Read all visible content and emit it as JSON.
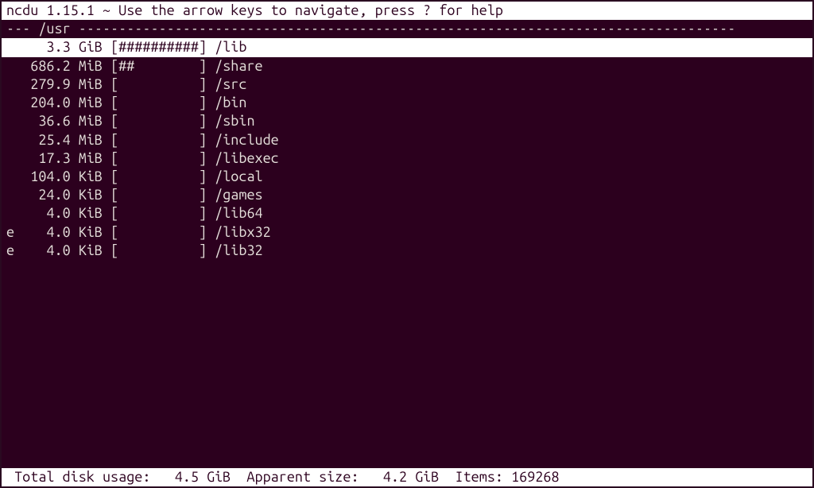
{
  "header": {
    "app_version": "ncdu 1.15.1 ~ Use the arrow keys to navigate, press ",
    "help_key": "?",
    "help_suffix": " for help"
  },
  "path": {
    "prefix": "--- ",
    "dir": "/usr",
    "dashes": " ----------------------------------------------------------------------------------"
  },
  "rows": [
    {
      "flag": " ",
      "size": "    3.3 GiB",
      "bar": "[##########]",
      "name": " /lib",
      "selected": true
    },
    {
      "flag": " ",
      "size": "  686.2 MiB",
      "bar": "[##        ]",
      "name": " /share",
      "selected": false
    },
    {
      "flag": " ",
      "size": "  279.9 MiB",
      "bar": "[          ]",
      "name": " /src",
      "selected": false
    },
    {
      "flag": " ",
      "size": "  204.0 MiB",
      "bar": "[          ]",
      "name": " /bin",
      "selected": false
    },
    {
      "flag": " ",
      "size": "   36.6 MiB",
      "bar": "[          ]",
      "name": " /sbin",
      "selected": false
    },
    {
      "flag": " ",
      "size": "   25.4 MiB",
      "bar": "[          ]",
      "name": " /include",
      "selected": false
    },
    {
      "flag": " ",
      "size": "   17.3 MiB",
      "bar": "[          ]",
      "name": " /libexec",
      "selected": false
    },
    {
      "flag": " ",
      "size": "  104.0 KiB",
      "bar": "[          ]",
      "name": " /local",
      "selected": false
    },
    {
      "flag": " ",
      "size": "   24.0 KiB",
      "bar": "[          ]",
      "name": " /games",
      "selected": false
    },
    {
      "flag": " ",
      "size": "    4.0 KiB",
      "bar": "[          ]",
      "name": " /lib64",
      "selected": false
    },
    {
      "flag": "e",
      "size": "    4.0 KiB",
      "bar": "[          ]",
      "name": " /libx32",
      "selected": false
    },
    {
      "flag": "e",
      "size": "    4.0 KiB",
      "bar": "[          ]",
      "name": " /lib32",
      "selected": false
    }
  ],
  "footer": {
    "total_label": " Total disk usage:",
    "total_value": "   4.5 GiB",
    "apparent_label": "  Apparent size:",
    "apparent_value": "   4.2 GiB",
    "items_label": "  Items:",
    "items_value": " 169268"
  }
}
